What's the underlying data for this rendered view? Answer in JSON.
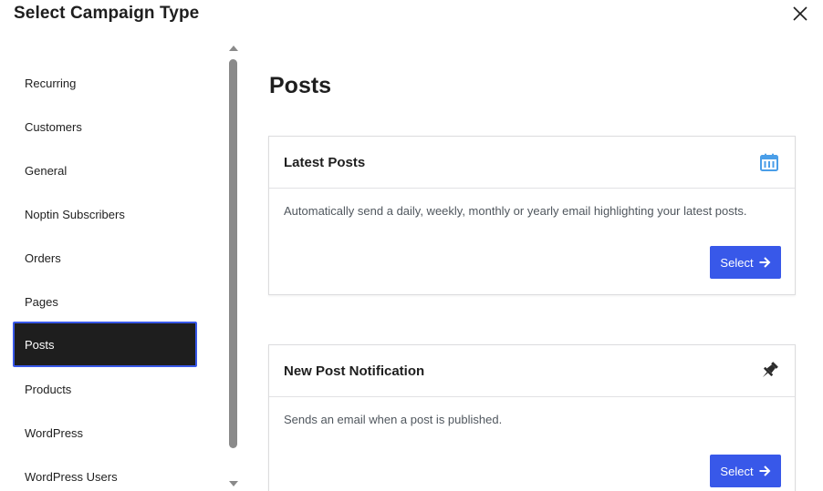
{
  "modal": {
    "title": "Select Campaign Type"
  },
  "sidebar": {
    "items": [
      {
        "label": "Recurring",
        "active": false
      },
      {
        "label": "Customers",
        "active": false
      },
      {
        "label": "General",
        "active": false
      },
      {
        "label": "Noptin Subscribers",
        "active": false
      },
      {
        "label": "Orders",
        "active": false
      },
      {
        "label": "Pages",
        "active": false
      },
      {
        "label": "Posts",
        "active": true
      },
      {
        "label": "Products",
        "active": false
      },
      {
        "label": "WordPress",
        "active": false
      },
      {
        "label": "WordPress Users",
        "active": false
      }
    ]
  },
  "main": {
    "section_title": "Posts",
    "cards": [
      {
        "title": "Latest Posts",
        "icon": "calendar-icon",
        "description": "Automatically send a daily, weekly, monthly or yearly email highlighting your latest posts.",
        "button_label": "Select"
      },
      {
        "title": "New Post Notification",
        "icon": "pin-icon",
        "description": "Sends an email when a post is published.",
        "button_label": "Select"
      }
    ]
  },
  "colors": {
    "accent": "#3858e9",
    "active_item_bg": "#1e1e1e",
    "calendar_icon": "#4a9ee8",
    "text": "#1e1e1e",
    "muted_text": "#50575e"
  }
}
